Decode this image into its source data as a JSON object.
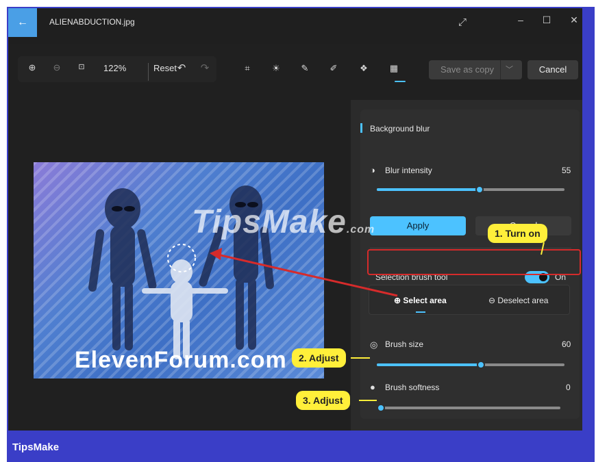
{
  "window": {
    "title": "ALIENABDUCTION.jpg",
    "back_icon": "arrow-left-icon",
    "expand_icon": "expand-icon",
    "minimize_icon": "minimize-icon",
    "maximize_icon": "maximize-icon",
    "close_icon": "close-icon"
  },
  "toolbar": {
    "zoom_level": "122%",
    "reset_label": "Reset",
    "save_label": "Save as copy",
    "cancel_label": "Cancel"
  },
  "panel": {
    "section_title": "Background blur",
    "blur_intensity": {
      "label": "Blur intensity",
      "value": "55",
      "fraction": 0.55
    },
    "apply_label": "Apply",
    "cancel_label": "Cancel",
    "selection_brush": {
      "label": "Selection brush tool",
      "state": "On"
    },
    "select_area_label": "Select area",
    "deselect_area_label": "Deselect area",
    "brush_size": {
      "label": "Brush size",
      "value": "60",
      "fraction": 0.6
    },
    "brush_softness": {
      "label": "Brush softness",
      "value": "0",
      "fraction": 0.0
    }
  },
  "annotations": {
    "turn_on": "1. Turn on",
    "adjust_1": "2. Adjust",
    "adjust_2": "3. Adjust"
  },
  "watermarks": {
    "tipsmake": "TipsMake",
    "tipsmake_suffix": ".com",
    "elevenforum": "ElevenForum.com",
    "brand": "TipsMake"
  },
  "colors": {
    "accent": "#4cc2ff",
    "callout": "#ffef3a",
    "highlight_border": "#d62b2b",
    "frame": "#3a3ec7"
  }
}
